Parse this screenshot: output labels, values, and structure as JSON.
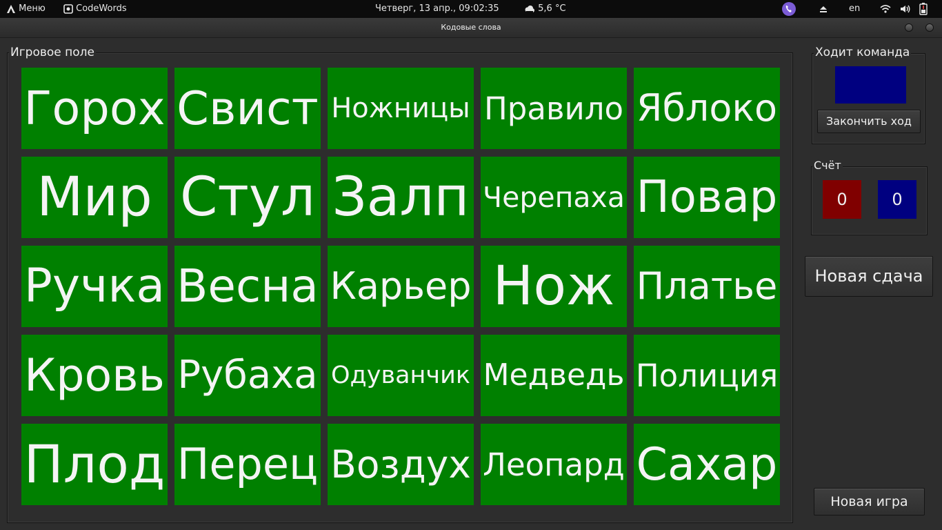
{
  "top_panel": {
    "menu_label": "Меню",
    "app_label": "CodeWords",
    "datetime": "Четверг, 13 апр., 09:02:35",
    "weather": "5,6 °C",
    "language": "en"
  },
  "window": {
    "title": "Кодовые слова"
  },
  "game_field": {
    "legend": "Игровое поле",
    "card_color": "#008000",
    "rows": [
      [
        "Горох",
        "Свист",
        "Ножницы",
        "Правило",
        "Яблоко"
      ],
      [
        "Мир",
        "Стул",
        "Залп",
        "Черепаха",
        "Повар"
      ],
      [
        "Ручка",
        "Весна",
        "Карьер",
        "Нож",
        "Платье"
      ],
      [
        "Кровь",
        "Рубаха",
        "Одуванчик",
        "Медведь",
        "Полиция"
      ],
      [
        "Плод",
        "Перец",
        "Воздух",
        "Леопард",
        "Сахар"
      ]
    ]
  },
  "turn": {
    "legend": "Ходит команда",
    "current_team_color": "#000080",
    "end_turn_label": "Закончить ход"
  },
  "score": {
    "legend": "Счёт",
    "red": "0",
    "blue": "0",
    "red_color": "#800000",
    "blue_color": "#000080"
  },
  "new_deal_label": "Новая сдача",
  "new_game_label": "Новая игра"
}
